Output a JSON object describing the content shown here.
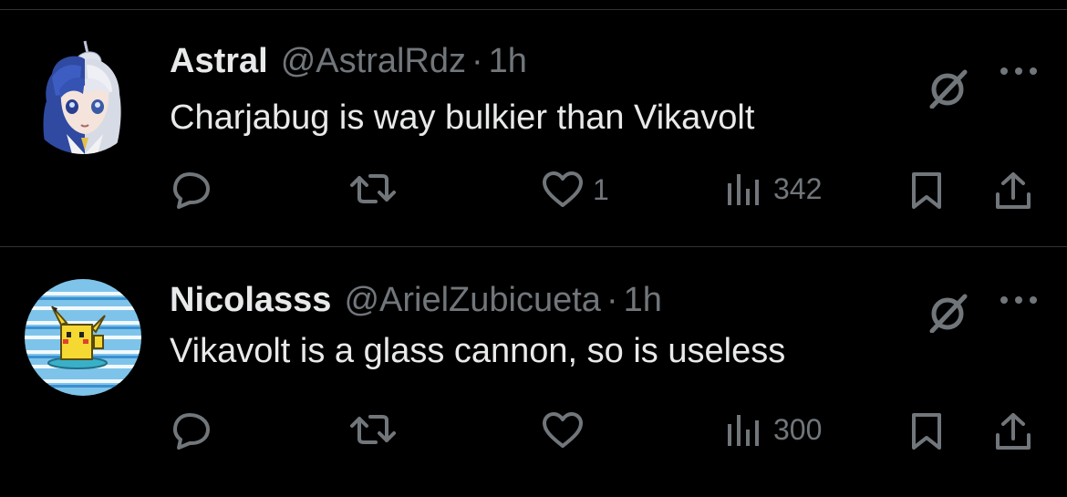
{
  "posts": [
    {
      "display_name": "Astral",
      "handle": "@AstralRdz",
      "separator": "·",
      "time": "1h",
      "text": "Charjabug is way bulkier than Vikavolt",
      "avatar": "anime-avatar",
      "like_count": "1",
      "view_count": "342"
    },
    {
      "display_name": "Nicolasss",
      "handle": "@ArielZubicueta",
      "separator": "·",
      "time": "1h",
      "text": "Vikavolt is a glass cannon, so is useless",
      "avatar": "pikachu-surfing-avatar",
      "like_count": "",
      "view_count": "300"
    }
  ],
  "icons": {
    "reply": "reply-icon",
    "repost": "repost-icon",
    "like": "heart-icon",
    "views": "views-icon",
    "bookmark": "bookmark-icon",
    "share": "share-icon",
    "grok": "grok-icon",
    "more": "more-icon"
  },
  "colors": {
    "background": "#000000",
    "text": "#e7e9ea",
    "secondary": "#71767b",
    "divider": "#2f3336"
  }
}
